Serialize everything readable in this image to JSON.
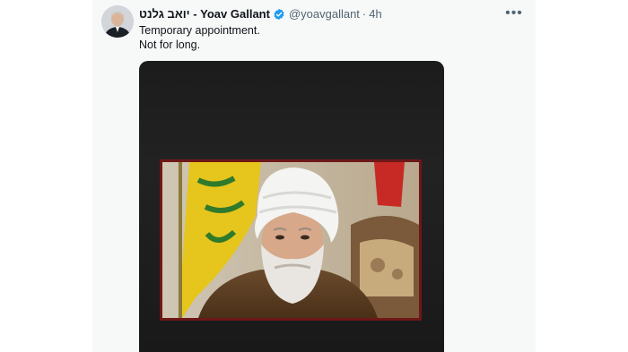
{
  "tweet": {
    "author": {
      "display_name": "יואב גלנט - Yoav Gallant",
      "handle": "@yoavgallant",
      "verified": true,
      "avatar_icon": "avatar-photo"
    },
    "separator": "·",
    "timestamp": "4h",
    "more_icon": "more-horizontal-icon",
    "more_label": "•••",
    "text_lines": [
      "Temporary appointment.",
      "Not for long."
    ],
    "media": {
      "kind": "photo",
      "description_icon": "portrait-photo"
    }
  },
  "colors": {
    "name_text": "#0f1419",
    "secondary_text": "#536471",
    "verified_blue": "#1d9bf0",
    "card_background": "#f7f9f9",
    "media_background": "#1c1c1c",
    "frame_red": "#6e1717"
  }
}
